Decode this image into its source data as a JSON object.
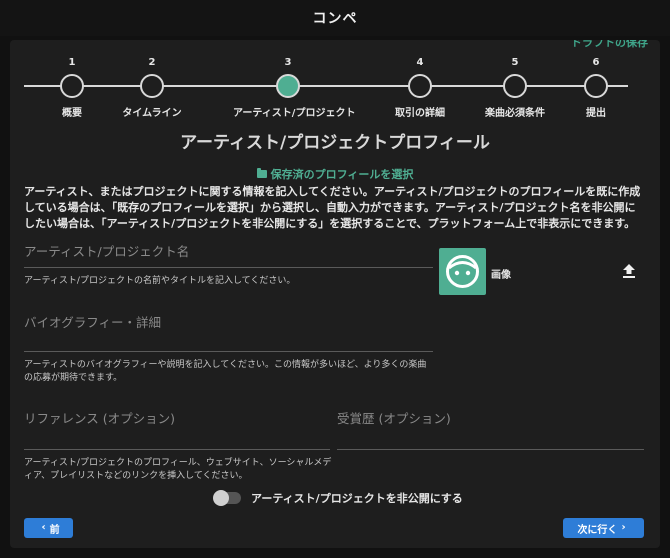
{
  "window": {
    "title": "コンペ"
  },
  "draft_save": "ドラフトの保存",
  "stepper": {
    "steps": [
      {
        "number": "1",
        "label": "概要",
        "active": false
      },
      {
        "number": "2",
        "label": "タイムライン",
        "active": false
      },
      {
        "number": "3",
        "label": "アーティスト/プロジェクト",
        "active": true
      },
      {
        "number": "4",
        "label": "取引の詳細",
        "active": false
      },
      {
        "number": "5",
        "label": "楽曲必須条件",
        "active": false
      },
      {
        "number": "6",
        "label": "提出",
        "active": false
      }
    ]
  },
  "page_title": "アーティスト/プロジェクトプロフィール",
  "saved_profile_link": "保存済のプロフィールを選択",
  "description": "アーティスト、またはプロジェクトに関する情報を記入してください。アーティスト/プロジェクトのプロフィールを既に作成している場合は、「既存のプロフィールを選択」から選択し、自動入力ができます。アーティスト/プロジェクト名を非公開にしたい場合は、「アーティスト/プロジェクトを非公開にする」を選択することで、プラットフォーム上で非表示にできます。",
  "fields": {
    "name": {
      "placeholder": "アーティスト/プロジェクト名",
      "value": "",
      "helper": "アーティスト/プロジェクトの名前やタイトルを記入してください。"
    },
    "bio": {
      "placeholder": "バイオグラフィー・詳細",
      "value": "",
      "helper": "アーティストのバイオグラフィーや説明を記入してください。この情報が多いほど、より多くの楽曲の応募が期待できます。"
    },
    "reference": {
      "placeholder": "リファレンス (オプション)",
      "value": "",
      "helper": "アーティスト/プロジェクトのプロフィール、ウェブサイト、ソーシャルメディア、プレイリストなどのリンクを挿入してください。"
    },
    "awards": {
      "placeholder": "受賞歴 (オプション)",
      "value": ""
    }
  },
  "image": {
    "label": "画像",
    "icon": "avatar-face-icon",
    "upload_icon": "upload-icon"
  },
  "private_toggle": {
    "label": "アーティスト/プロジェクトを非公開にする",
    "checked": false
  },
  "buttons": {
    "prev": "前",
    "next": "次に行く"
  },
  "colors": {
    "accent": "#4fae92",
    "primary_button": "#2e7dd7",
    "background": "#111111",
    "panel": "#1e1e1e"
  }
}
